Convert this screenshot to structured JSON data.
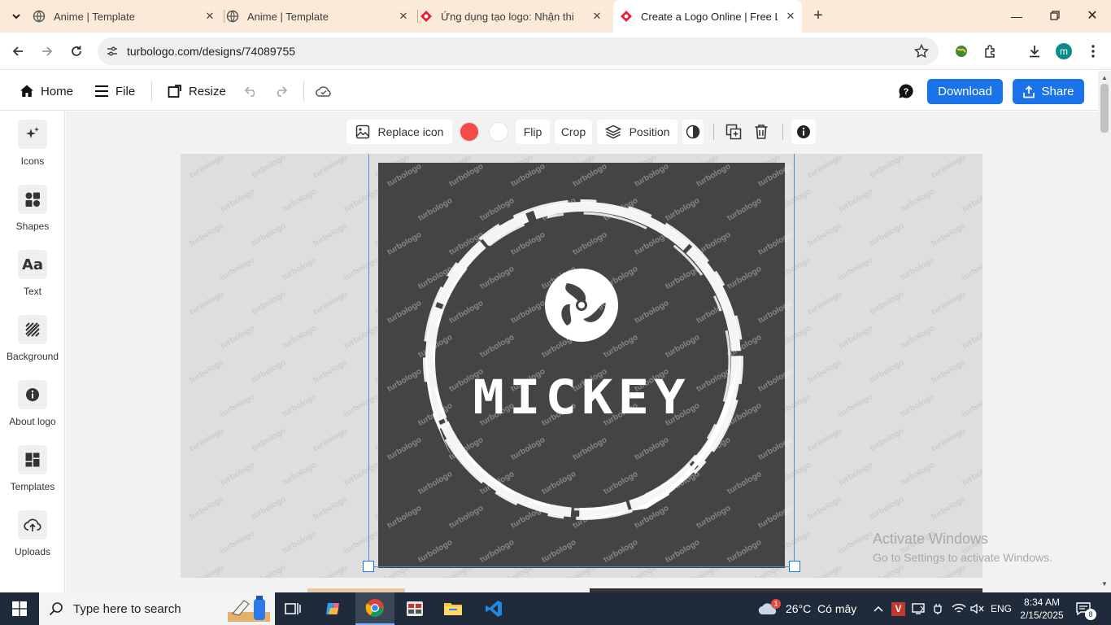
{
  "browser": {
    "tabs": [
      {
        "title": "Anime | Template",
        "active": false
      },
      {
        "title": "Anime | Template",
        "active": false
      },
      {
        "title": "Ứng dụng tạo logo: Nhận thiết",
        "active": false
      },
      {
        "title": "Create a Logo Online | Free Log",
        "active": true
      }
    ],
    "url": "turbologo.com/designs/74089755",
    "profile_initial": "m"
  },
  "header": {
    "home_label": "Home",
    "file_label": "File",
    "resize_label": "Resize",
    "download_label": "Download",
    "share_label": "Share"
  },
  "sidebar": {
    "items": [
      {
        "label": "Icons",
        "icon": "sparkle-icon"
      },
      {
        "label": "Shapes",
        "icon": "shapes-icon"
      },
      {
        "label": "Text",
        "icon": "text-icon"
      },
      {
        "label": "Background",
        "icon": "stripes-icon"
      },
      {
        "label": "About logo",
        "icon": "info-icon"
      },
      {
        "label": "Templates",
        "icon": "grid-icon"
      },
      {
        "label": "Uploads",
        "icon": "upload-cloud-icon"
      }
    ]
  },
  "toolbar": {
    "replace_icon_label": "Replace icon",
    "flip_label": "Flip",
    "crop_label": "Crop",
    "position_label": "Position",
    "color_primary": "#f44a4a",
    "color_secondary": "#ffffff"
  },
  "logo": {
    "text": "MICKEY",
    "background_color": "#444444",
    "foreground_color": "#ffffff",
    "watermark": "turbologo"
  },
  "system": {
    "activate_title": "Activate Windows",
    "activate_sub": "Go to Settings to activate Windows.",
    "search_placeholder": "Type here to search",
    "weather": "26°C  Có mây",
    "weather_badge": "1",
    "language": "ENG",
    "time": "8:34 AM",
    "date": "2/15/2025",
    "notifications": "8"
  }
}
